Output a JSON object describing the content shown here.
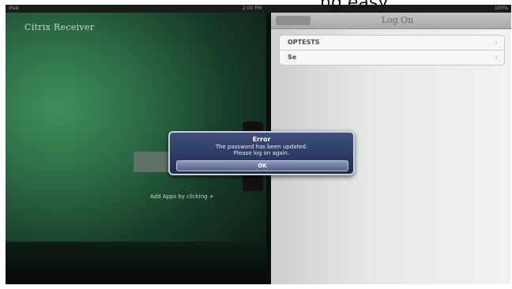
{
  "caption": "ng easy",
  "status_bar": {
    "carrier": "iPad",
    "time": "2:00 PM",
    "battery": "100%"
  },
  "left": {
    "app_title": "Citrix Receiver",
    "add_hint": "Add Apps by clicking +"
  },
  "right": {
    "nav_title": "Log On",
    "accounts": [
      {
        "label": "OPTESTS"
      },
      {
        "label": "Se"
      }
    ]
  },
  "alert": {
    "title": "Error",
    "message_line1": "The password has been updated.",
    "message_line2": "Please log on again.",
    "button": "OK"
  }
}
